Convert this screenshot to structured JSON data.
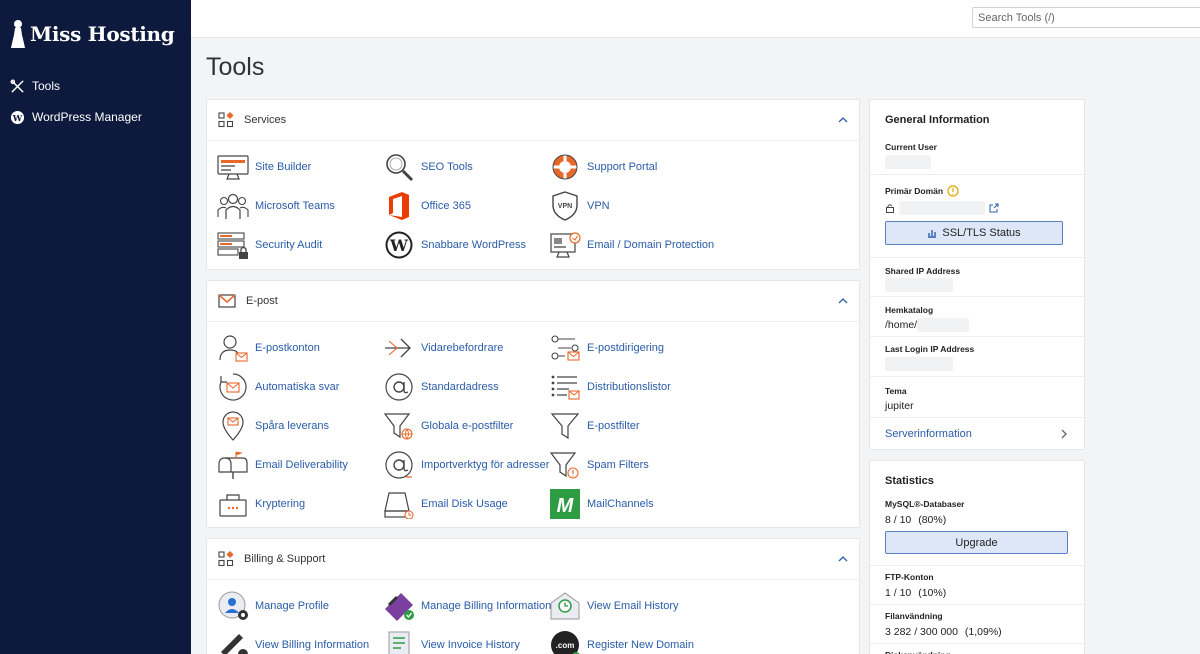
{
  "brand": {
    "name": "Miss Hosting"
  },
  "nav": [
    {
      "label": "Tools",
      "icon": "tools-icon"
    },
    {
      "label": "WordPress Manager",
      "icon": "wordpress-icon"
    }
  ],
  "search": {
    "placeholder": "Search Tools (/)"
  },
  "page_title": "Tools",
  "panels": {
    "services": {
      "title": "Services",
      "tools": [
        {
          "label": "Site Builder",
          "icon": "site-builder-icon"
        },
        {
          "label": "SEO Tools",
          "icon": "seo-magnifier-icon"
        },
        {
          "label": "Support Portal",
          "icon": "lifebuoy-icon"
        },
        {
          "label": "Microsoft Teams",
          "icon": "team-people-icon"
        },
        {
          "label": "Office 365",
          "icon": "office-365-icon"
        },
        {
          "label": "VPN",
          "icon": "vpn-shield-icon"
        },
        {
          "label": "Security Audit",
          "icon": "security-audit-icon"
        },
        {
          "label": "Snabbare WordPress",
          "icon": "wordpress-logo-icon"
        },
        {
          "label": "Email / Domain Protection",
          "icon": "email-protection-icon"
        }
      ]
    },
    "epost": {
      "title": "E-post",
      "tools": [
        {
          "label": "E-postkonton",
          "icon": "email-account-icon"
        },
        {
          "label": "Vidarebefordrare",
          "icon": "forwarder-arrow-icon"
        },
        {
          "label": "E-postdirigering",
          "icon": "email-routing-icon"
        },
        {
          "label": "Automatiska svar",
          "icon": "autoresponder-icon"
        },
        {
          "label": "Standardadress",
          "icon": "at-sign-icon"
        },
        {
          "label": "Distributionslistor",
          "icon": "mailing-list-icon"
        },
        {
          "label": "Spåra leverans",
          "icon": "track-delivery-pin-icon"
        },
        {
          "label": "Globala e-postfilter",
          "icon": "global-filter-icon"
        },
        {
          "label": "E-postfilter",
          "icon": "filter-funnel-icon"
        },
        {
          "label": "Email Deliverability",
          "icon": "mailbox-icon"
        },
        {
          "label": "Importverktyg för adresser",
          "icon": "address-importer-icon"
        },
        {
          "label": "Spam Filters",
          "icon": "spam-filter-icon"
        },
        {
          "label": "Kryptering",
          "icon": "encryption-icon"
        },
        {
          "label": "Email Disk Usage",
          "icon": "disk-usage-icon"
        },
        {
          "label": "MailChannels",
          "icon": "mailchannels-logo-icon"
        }
      ]
    },
    "billing": {
      "title": "Billing & Support",
      "tools": [
        {
          "label": "Manage Profile",
          "icon": "profile-gear-icon"
        },
        {
          "label": "Manage Billing Information",
          "icon": "credit-card-icon"
        },
        {
          "label": "View Email History",
          "icon": "email-history-icon"
        },
        {
          "label": "View Billing Information",
          "icon": "billing-info-icon"
        },
        {
          "label": "View Invoice History",
          "icon": "invoice-icon"
        },
        {
          "label": "Register New Domain",
          "icon": "dotcom-domain-icon"
        }
      ]
    }
  },
  "general_info": {
    "title": "General Information",
    "current_user_label": "Current User",
    "primary_domain_label": "Primär Domän",
    "ssl_button": "SSL/TLS Status",
    "shared_ip_label": "Shared IP Address",
    "home_dir_label": "Hemkatalog",
    "home_dir_value": "/home/",
    "last_login_label": "Last Login IP Address",
    "theme_label": "Tema",
    "theme_value": "jupiter",
    "server_info_link": "Serverinformation"
  },
  "statistics": {
    "title": "Statistics",
    "mysql_label": "MySQL®-Databaser",
    "mysql_value": "8 / 10",
    "mysql_percent": "(80%)",
    "upgrade_button": "Upgrade",
    "ftp_label": "FTP-Konton",
    "ftp_value": "1 / 10",
    "ftp_percent": "(10%)",
    "file_usage_label": "Filanvändning",
    "file_usage_value": "3 282 / 300 000",
    "file_usage_percent": "(1,09%)",
    "disk_usage_label": "Diskanvändning"
  },
  "colors": {
    "sidebar": "#0d1a3d",
    "link": "#2a5ca8",
    "accent": "#e8682a",
    "button_bg": "#dde7f7"
  }
}
